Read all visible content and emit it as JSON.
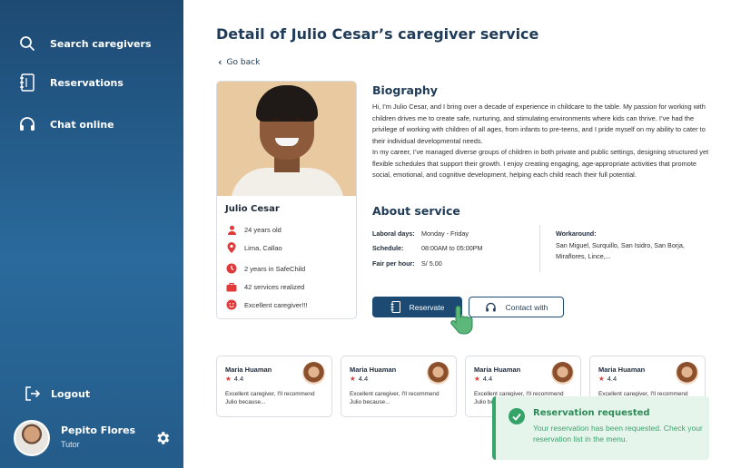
{
  "sidebar": {
    "items": [
      {
        "label": "Search caregivers",
        "icon": "search-icon"
      },
      {
        "label": "Reservations",
        "icon": "notebook-icon"
      },
      {
        "label": "Chat online",
        "icon": "headset-icon"
      }
    ],
    "logout_label": "Logout",
    "user": {
      "name": "Pepito Flores",
      "role": "Tutor"
    }
  },
  "main": {
    "title": "Detail of Julio Cesar’s caregiver service",
    "back_label": "Go back",
    "profile": {
      "name": "Julio Cesar",
      "details": [
        {
          "icon": "person-icon",
          "text": "24 years old"
        },
        {
          "icon": "location-pin-icon",
          "text": "Lima, Callao"
        },
        {
          "icon": "clock-icon",
          "text": "2 years in SafeChild"
        },
        {
          "icon": "briefcase-icon",
          "text": "42 services realized"
        },
        {
          "icon": "smiley-icon",
          "text": "Excellent caregiver!!!"
        }
      ]
    },
    "biography": {
      "title": "Biography",
      "paragraphs": [
        "Hi, I’m Julio Cesar, and I bring over a decade of experience in childcare to the table. My passion for working with children drives me to create safe, nurturing, and stimulating environments where kids can thrive. I’ve had the privilege of working with children of all ages, from infants to pre-teens, and I pride myself on my ability to cater to their individual developmental needs.",
        "In my career, I’ve managed diverse groups of children in both private and public settings, designing structured yet flexible schedules that support their growth. I enjoy creating engaging, age-appropriate activities that promote social, emotional, and cognitive development, helping each child reach their full potential."
      ]
    },
    "service": {
      "title": "About service",
      "laboral_days_label": "Laboral days:",
      "laboral_days_value": "Monday - Friday",
      "schedule_label": "Schedule:",
      "schedule_value": "08:00AM to 05:00PM",
      "fare_label": "Fair per hour:",
      "fare_value": "S/ 5.00",
      "workaround_label": "Workaround:",
      "workaround_value": "San Miguel, Surquillo, San Isidro, San Borja, Miraflores, Lince,..."
    },
    "buttons": {
      "reserve": "Reservate",
      "contact": "Contact with"
    },
    "reviews": [
      {
        "name": "Maria Huaman",
        "rating": "4.4",
        "text": "Excellent caregiver, I'll recommend Julio because..."
      },
      {
        "name": "Maria Huaman",
        "rating": "4.4",
        "text": "Excellent caregiver, I'll recommend Julio because..."
      },
      {
        "name": "Maria Huaman",
        "rating": "4.4",
        "text": "Excellent caregiver, I'll recommend Julio because..."
      },
      {
        "name": "Maria Huaman",
        "rating": "4.4",
        "text": "Excellent caregiver, I'll recommend Julio because..."
      }
    ]
  },
  "toast": {
    "title": "Reservation requested",
    "message": "Your reservation has been requested. Check your reservation list in the menu."
  },
  "colors": {
    "sidebar": "#1d4a73",
    "accent": "#1d4a73",
    "icon_red": "#e03a3a",
    "success": "#35a268"
  }
}
